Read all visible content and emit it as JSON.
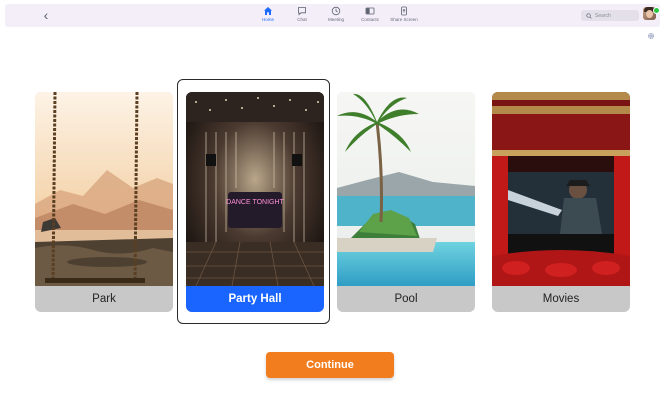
{
  "nav": {
    "items": [
      {
        "label": "Home",
        "icon": "home-icon",
        "active": true
      },
      {
        "label": "Chat",
        "icon": "chat-icon"
      },
      {
        "label": "Meeting",
        "icon": "clock-icon"
      },
      {
        "label": "Contacts",
        "icon": "contacts-icon"
      },
      {
        "label": "Share Screen",
        "icon": "share-screen-icon"
      }
    ]
  },
  "search": {
    "placeholder": "Search"
  },
  "rooms": [
    {
      "label": "Park"
    },
    {
      "label": "Party Hall",
      "selected": true,
      "sign_text": "DANCE TONIGHT"
    },
    {
      "label": "Pool"
    },
    {
      "label": "Movies"
    }
  ],
  "continue_label": "Continue",
  "colors": {
    "accent": "#1a64ff",
    "continue": "#f27d1f",
    "topbar": "#f3eef7"
  }
}
